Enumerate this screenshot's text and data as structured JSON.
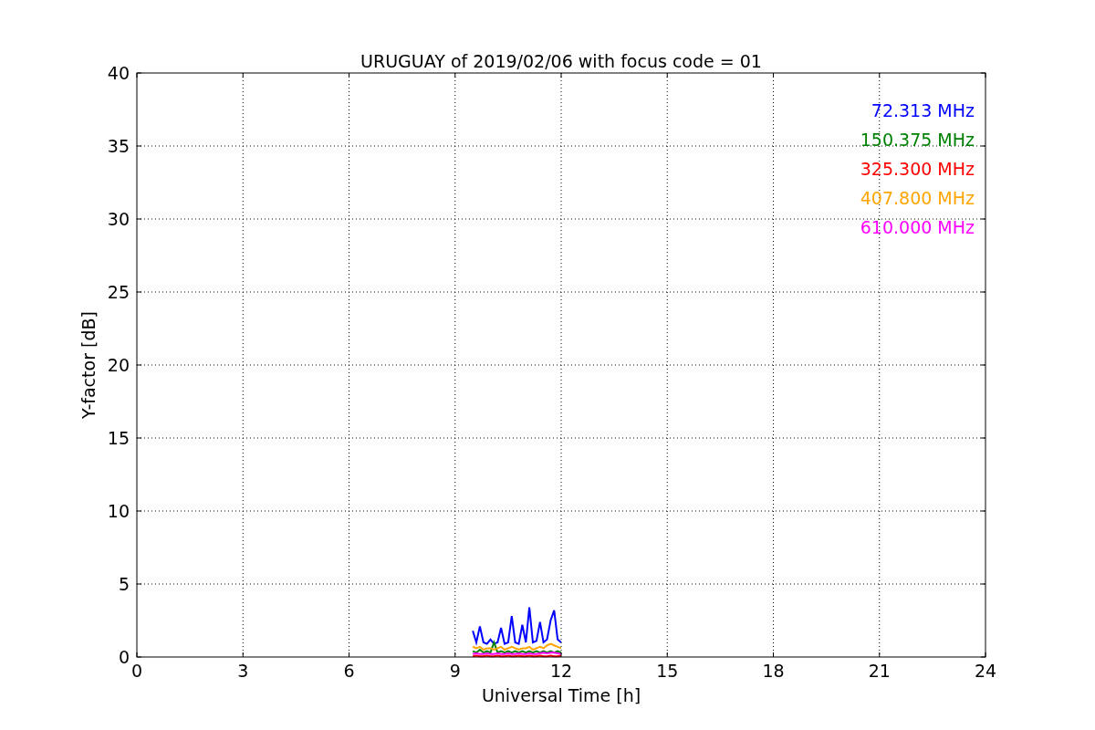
{
  "chart_data": {
    "type": "line",
    "title": "URUGUAY of 2019/02/06 with focus code = 01",
    "xlabel": "Universal Time [h]",
    "ylabel": "Y-factor [dB]",
    "x": [
      9.5,
      9.6,
      9.7,
      9.8,
      9.9,
      10.0,
      10.1,
      10.2,
      10.3,
      10.4,
      10.5,
      10.6,
      10.7,
      10.8,
      10.9,
      11.0,
      11.1,
      11.2,
      11.3,
      11.4,
      11.5,
      11.6,
      11.7,
      11.8,
      11.9,
      12.0
    ],
    "series": [
      {
        "name": "72.313 MHz",
        "color": "#0000ff",
        "values": [
          1.8,
          1.0,
          2.1,
          1.0,
          0.9,
          1.2,
          0.9,
          1.0,
          2.0,
          0.9,
          1.0,
          2.8,
          1.0,
          0.9,
          2.2,
          1.0,
          3.4,
          1.0,
          1.1,
          2.4,
          1.0,
          1.2,
          2.5,
          3.2,
          1.2,
          1.0
        ]
      },
      {
        "name": "150.375 MHz",
        "color": "#008000",
        "values": [
          0.4,
          0.3,
          0.5,
          0.3,
          0.4,
          0.3,
          1.0,
          0.3,
          0.4,
          0.3,
          0.4,
          0.3,
          0.4,
          0.3,
          0.4,
          0.3,
          0.4,
          0.3,
          0.4,
          0.3,
          0.4,
          0.3,
          0.4,
          0.3,
          0.4,
          0.3
        ]
      },
      {
        "name": "325.300 MHz",
        "color": "#ff0000",
        "values": [
          0.05,
          0.1,
          0.05,
          0.05,
          0.1,
          0.05,
          0.05,
          0.1,
          0.05,
          0.05,
          0.1,
          0.05,
          0.05,
          0.1,
          0.05,
          0.05,
          0.1,
          0.05,
          0.05,
          0.1,
          0.05,
          0.05,
          0.1,
          0.05,
          0.05,
          0.1
        ]
      },
      {
        "name": "407.800 MHz",
        "color": "#ffa500",
        "values": [
          0.7,
          0.6,
          0.7,
          0.5,
          0.6,
          0.6,
          0.5,
          0.6,
          0.7,
          0.5,
          0.6,
          0.7,
          0.6,
          0.5,
          0.6,
          0.6,
          0.7,
          0.5,
          0.6,
          0.7,
          0.6,
          0.8,
          0.9,
          0.8,
          0.7,
          0.6
        ]
      },
      {
        "name": "610.000 MHz",
        "color": "#ff00ff",
        "values": [
          0.2,
          0.25,
          0.2,
          0.2,
          0.25,
          0.2,
          0.2,
          0.25,
          0.2,
          0.2,
          0.25,
          0.2,
          0.2,
          0.25,
          0.2,
          0.2,
          0.25,
          0.2,
          0.2,
          0.25,
          0.3,
          0.25,
          0.3,
          0.3,
          0.25,
          0.2
        ]
      }
    ],
    "grid": true,
    "xlim": [
      0,
      24
    ],
    "ylim": [
      0,
      40
    ],
    "xticks": [
      0,
      3,
      6,
      9,
      12,
      15,
      18,
      21,
      24
    ],
    "yticks": [
      0,
      5,
      10,
      15,
      20,
      25,
      30,
      35,
      40
    ]
  }
}
